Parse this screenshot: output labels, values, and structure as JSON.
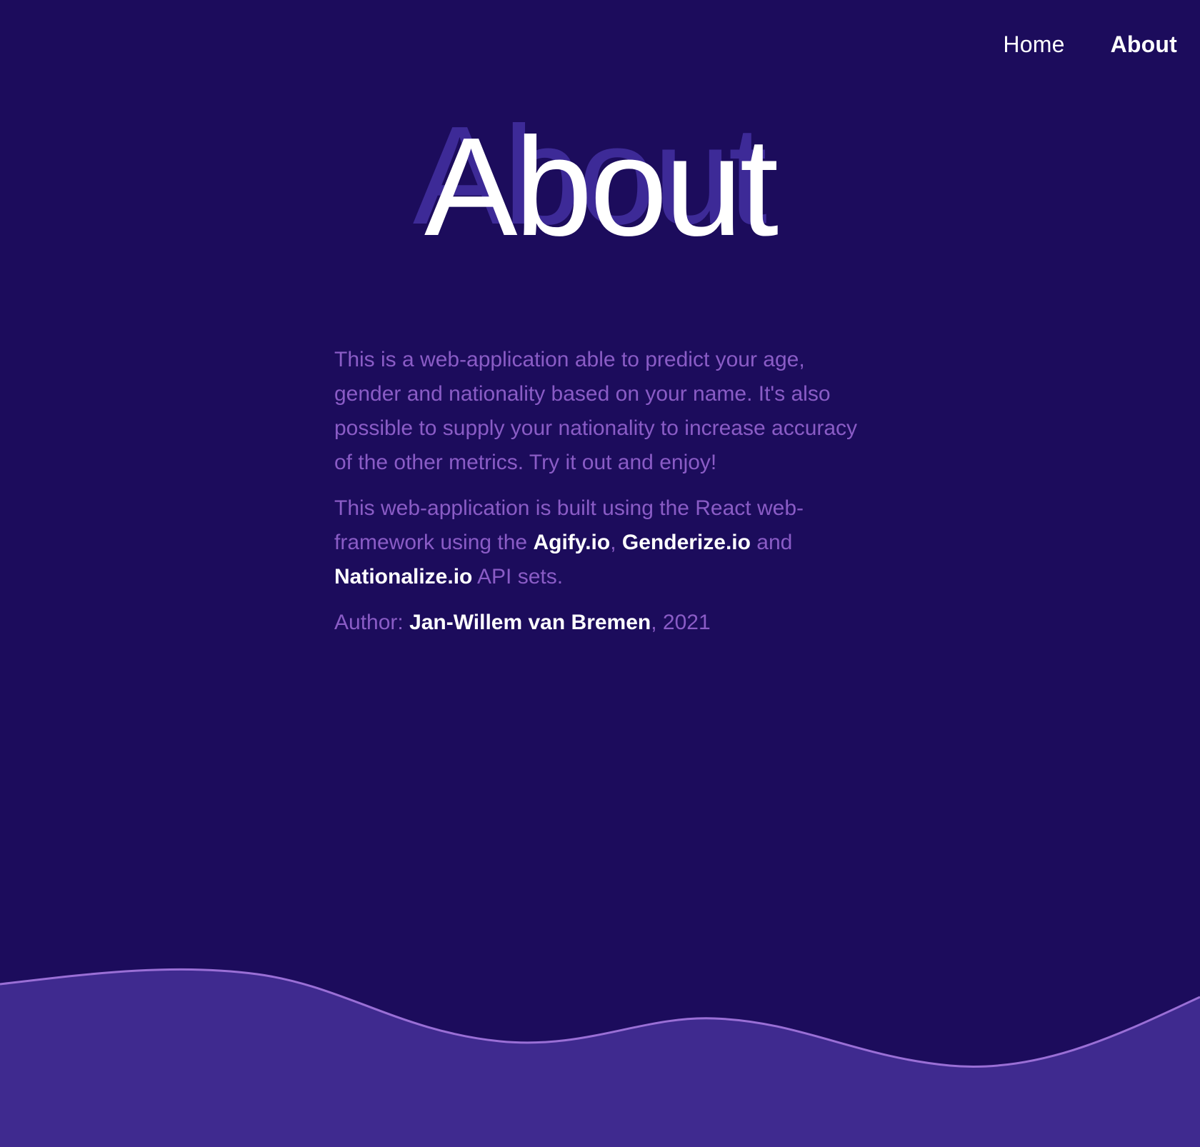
{
  "nav": {
    "home_label": "Home",
    "about_label": "About"
  },
  "page": {
    "title": "About"
  },
  "content": {
    "paragraph1": "This is a web-application able to predict your age, gender and nationality based on your name. It's also possible to supply your nationality to increase accuracy of the other metrics. Try it out and enjoy!",
    "paragraph2": {
      "prefix": "This web-application is built using the React web-framework using the ",
      "link_agify": "Agify.io",
      "sep1": ", ",
      "link_genderize": "Genderize.io",
      "sep2": " and ",
      "link_nationalize": "Nationalize.io",
      "suffix": " API sets."
    },
    "author": {
      "label": "Author: ",
      "name": "Jan-Willem van Bremen",
      "year_suffix": ", 2021"
    }
  },
  "colors": {
    "background": "#1c0c5c",
    "wave_fill": "#3f2a8f",
    "wave_stroke": "#9a6fd6",
    "muted_text": "#8a5cc6",
    "title_shadow": "#3d2a97",
    "highlight_text": "#ffffff"
  }
}
